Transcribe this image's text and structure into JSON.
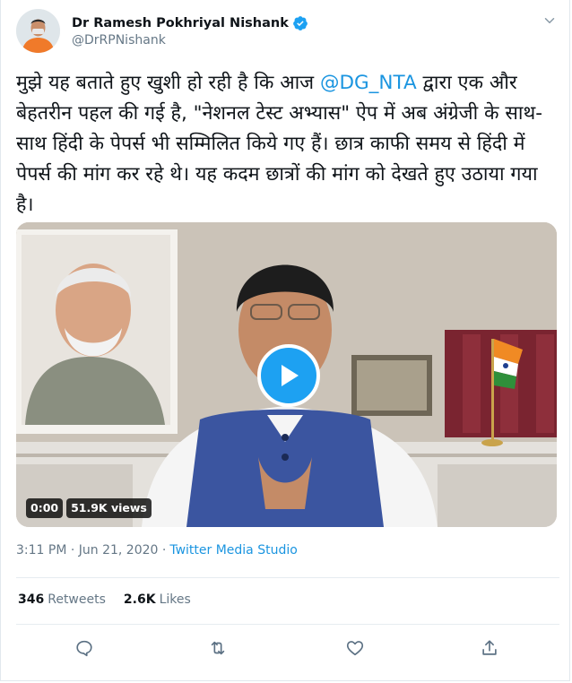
{
  "tweet": {
    "author_name": "Dr Ramesh Pokhriyal Nishank",
    "handle": "@DrRPNishank",
    "text_before_mention": "मुझे यह बताते हुए खुशी हो रही है कि आज ",
    "mention": "@DG_NTA",
    "text_after_mention": " द्वारा एक और बेहतरीन पहल की गई है, \"नेशनल टेस्ट अभ्यास\" ऐप में अब अंग्रेजी के साथ-साथ हिंदी के पेपर्स भी सम्मिलित किये गए हैं। छात्र काफी समय से हिंदी में पेपर्स की मांग कर रहे थे। यह कदम छात्रों की मांग को देखते हुए उठाया गया है।",
    "timestamp": "3:11 PM · Jun 21, 2020 ·",
    "source": "Twitter Media Studio"
  },
  "video": {
    "duration": "0:00",
    "views": "51.9K views"
  },
  "stats": {
    "retweets_count": "346",
    "retweets_label": "Retweets",
    "likes_count": "2.6K",
    "likes_label": "Likes"
  },
  "icons": {
    "verified": "verified-badge-icon",
    "caret": "chevron-down-icon",
    "reply": "reply-icon",
    "retweet": "retweet-icon",
    "like": "heart-icon",
    "share": "share-icon",
    "play": "play-icon"
  },
  "colors": {
    "accent": "#1da1f2",
    "link": "#1b95e0",
    "secondary_text": "#657786"
  }
}
